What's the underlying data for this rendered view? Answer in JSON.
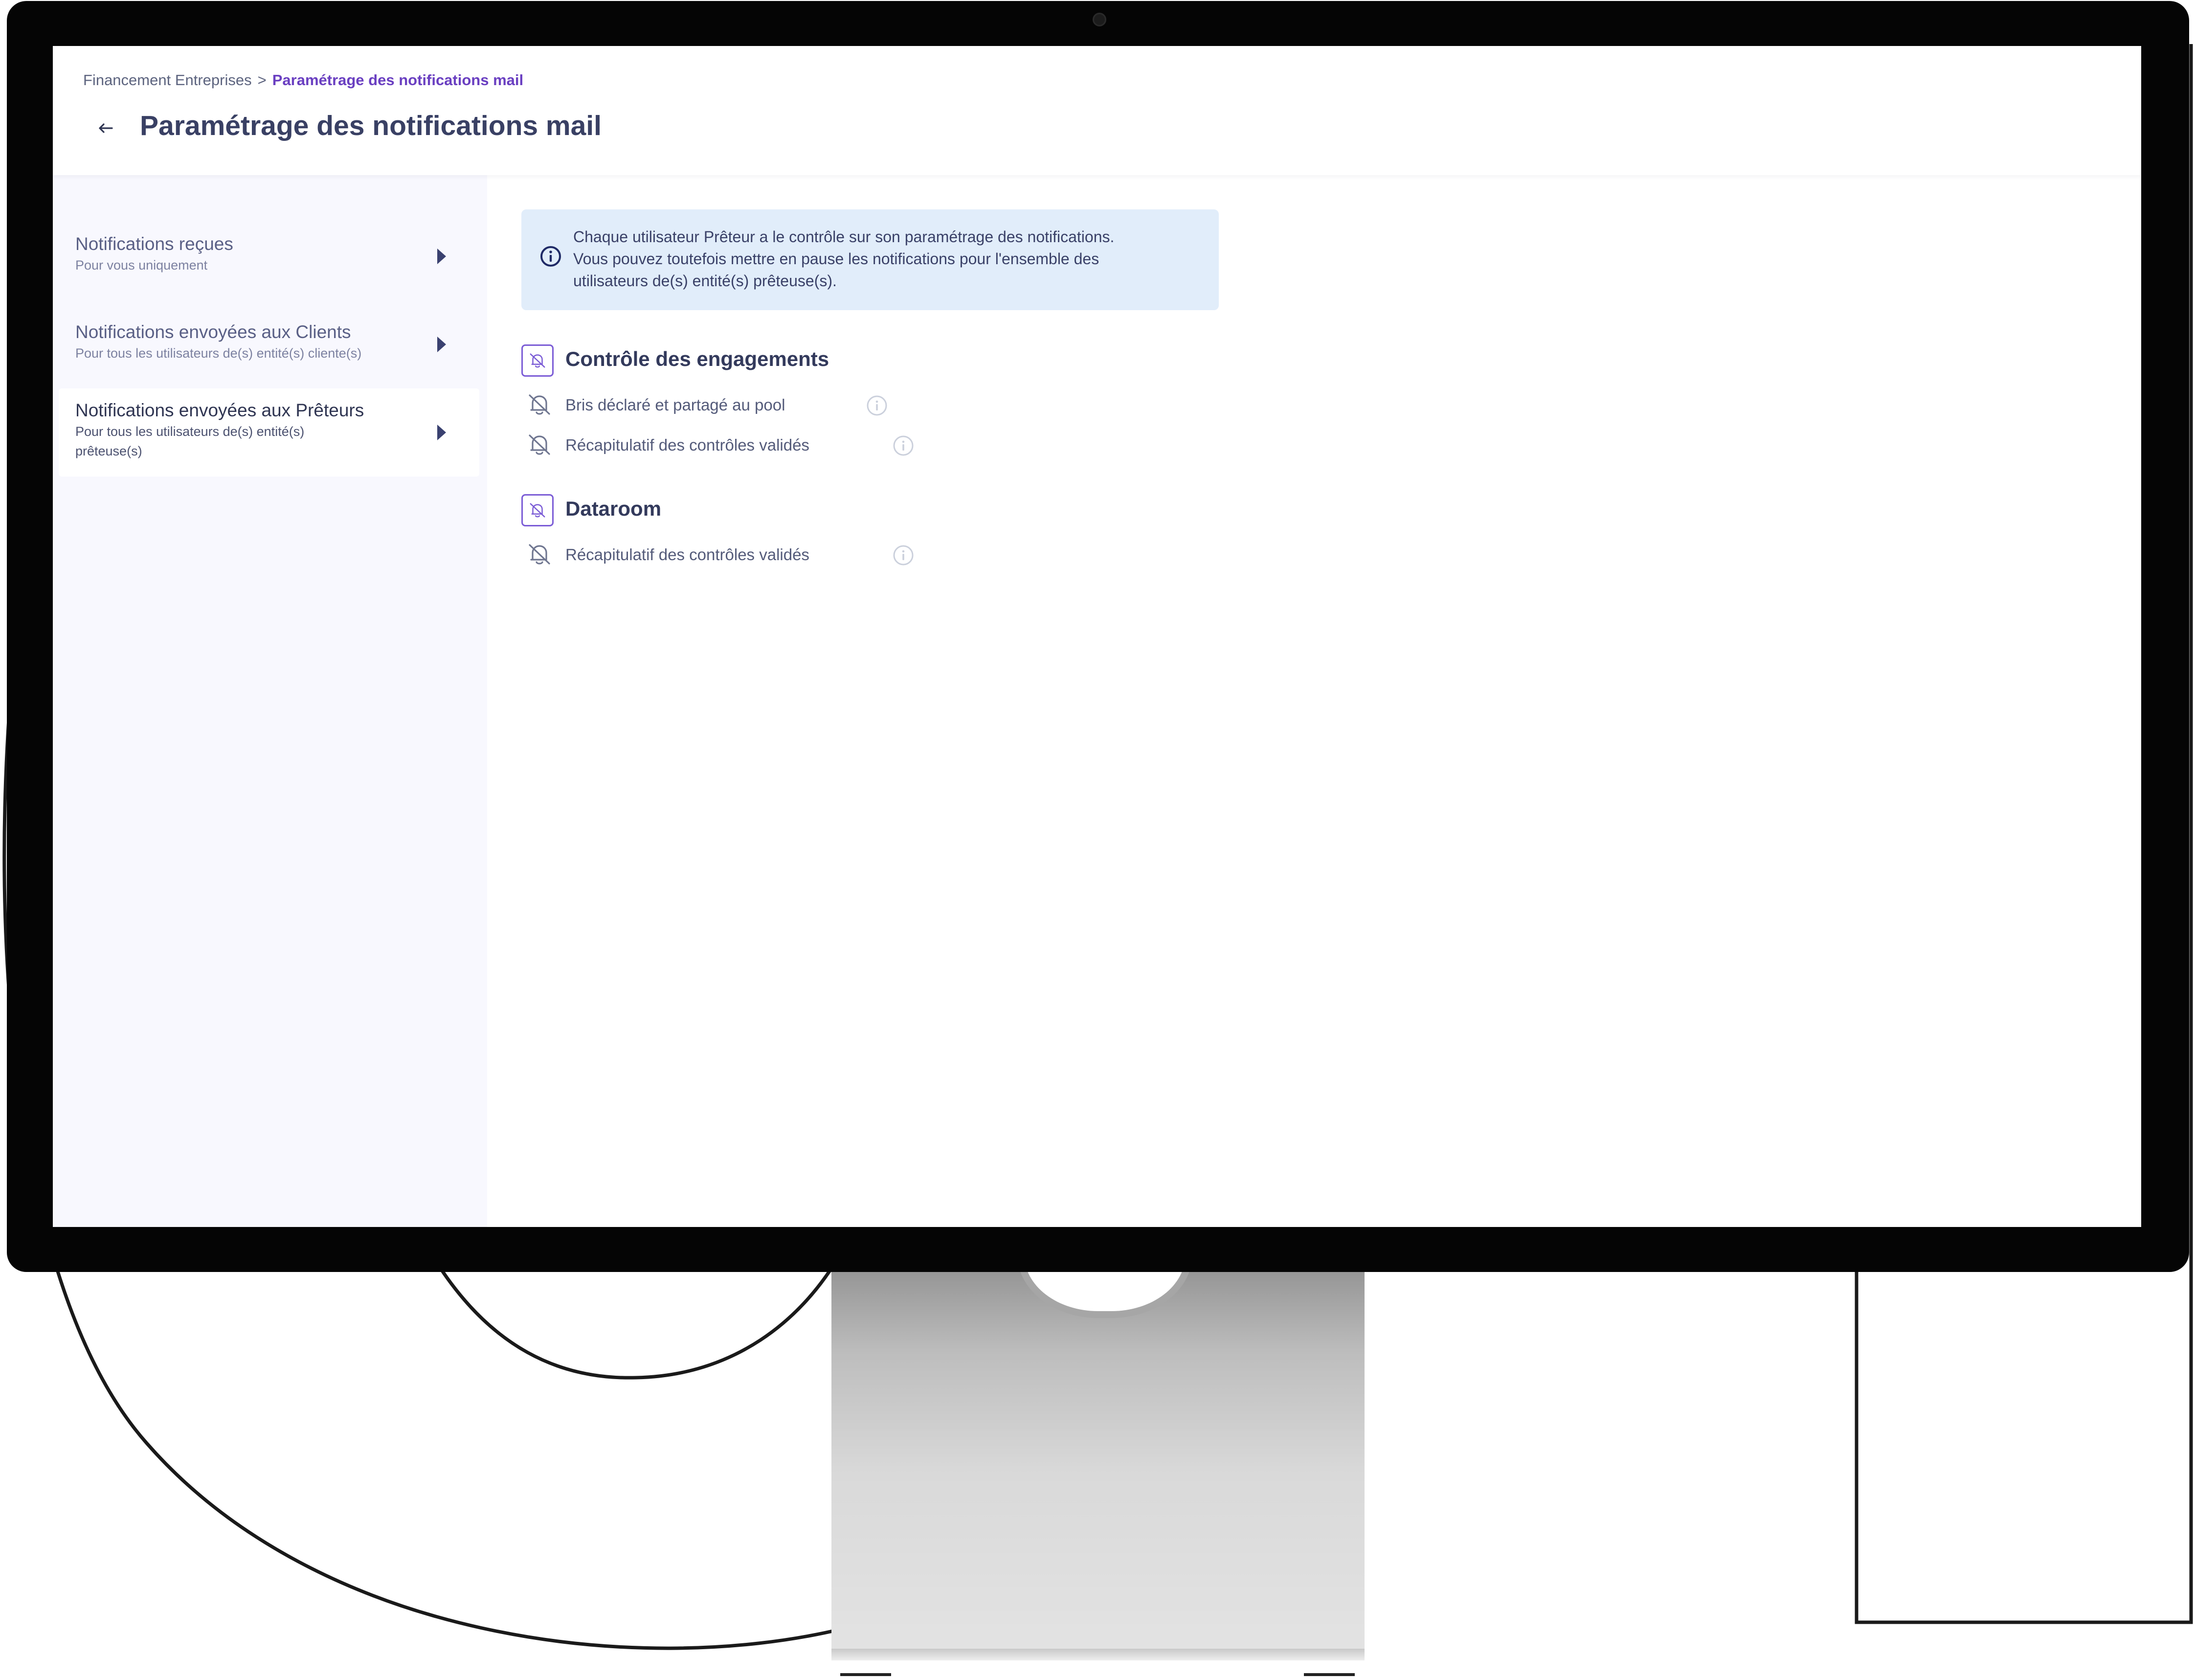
{
  "breadcrumb": {
    "parent": "Financement Entreprises",
    "separator": ">",
    "current": "Paramétrage des notifications mail"
  },
  "header": {
    "back_icon": "arrow-left-icon",
    "title": "Paramétrage des notifications mail"
  },
  "sidebar": {
    "items": [
      {
        "title": "Notifications reçues",
        "subtitle": "Pour vous uniquement",
        "active": false
      },
      {
        "title": "Notifications envoyées aux Clients",
        "subtitle": "Pour tous les utilisateurs de(s) entité(s) cliente(s)",
        "active": false
      },
      {
        "title": "Notifications envoyées aux Prêteurs",
        "subtitle": "Pour tous les utilisateurs de(s) entité(s) prêteuse(s)",
        "active": true
      }
    ]
  },
  "info": {
    "icon": "info-circle-icon",
    "line1": "Chaque utilisateur Prêteur a le contrôle sur son paramétrage des notifications.",
    "line2": "Vous pouvez toutefois mettre en pause les notifications pour l'ensemble des",
    "line3": "utilisateurs de(s) entité(s) prêteuse(s)."
  },
  "sections": [
    {
      "title": "Contrôle des engagements",
      "icon": "bell-off-icon",
      "rows": [
        {
          "label": "Bris déclaré et partagé au pool",
          "icon": "bell-off-icon"
        },
        {
          "label": "Récapitulatif des contrôles validés",
          "icon": "bell-off-icon"
        }
      ]
    },
    {
      "title": "Dataroom",
      "icon": "bell-off-icon",
      "rows": [
        {
          "label": "Récapitulatif des contrôles validés",
          "icon": "bell-off-icon"
        }
      ]
    }
  ],
  "colors": {
    "accent": "#6a3fc1",
    "title": "#394064",
    "info_bg": "#e1edfa",
    "sidebar_bg": "#f8f8fe"
  }
}
